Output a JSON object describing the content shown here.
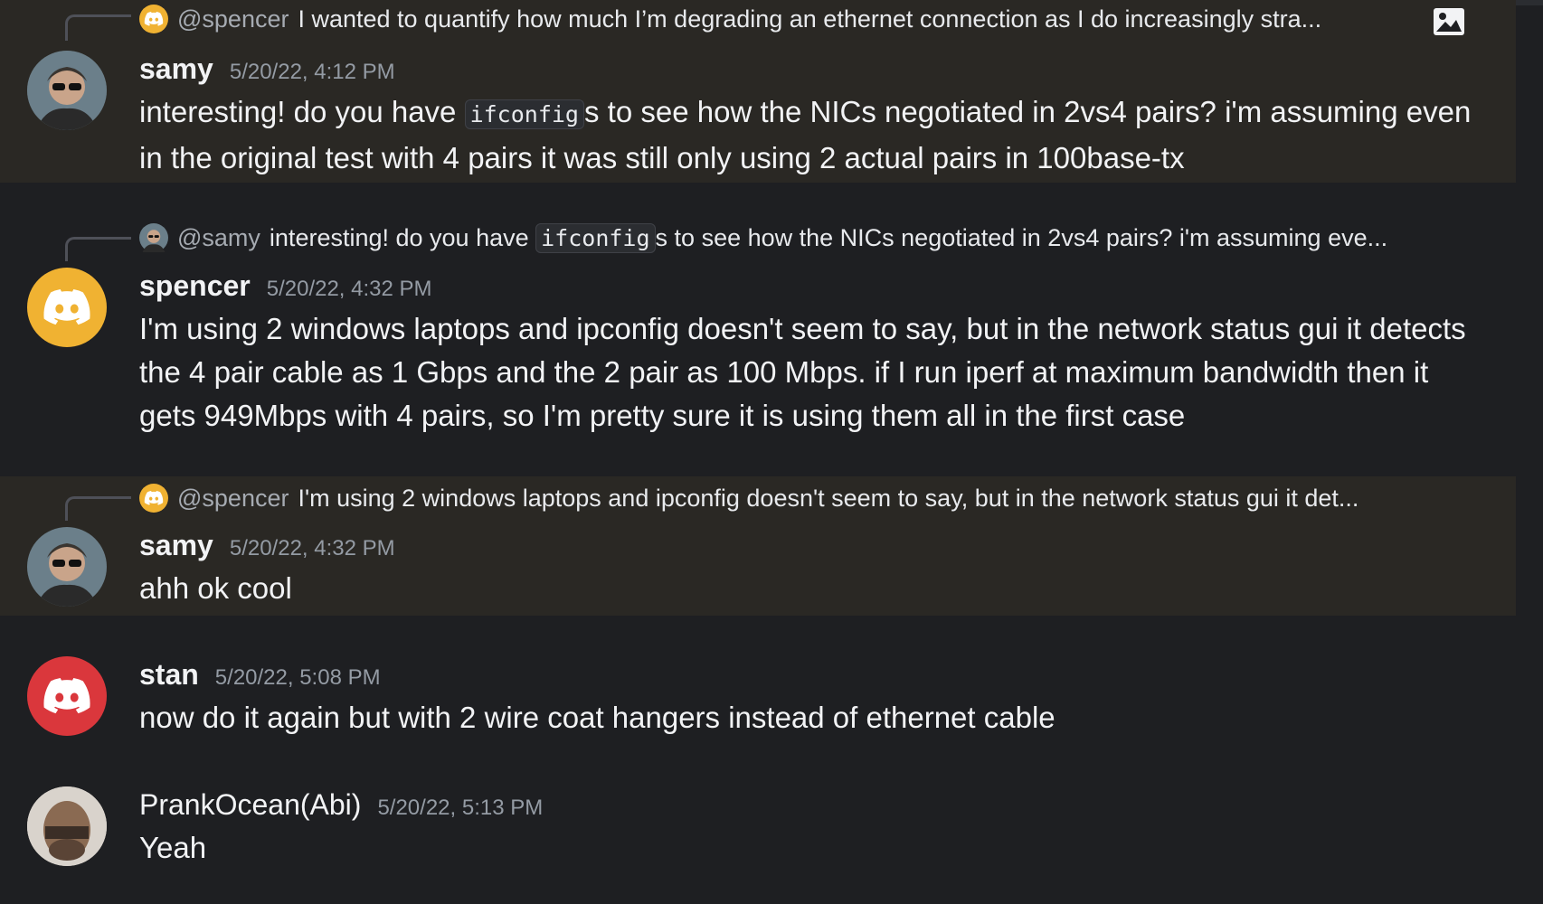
{
  "messages": [
    {
      "username": "samy",
      "timestamp": "5/20/22, 4:12 PM",
      "reply": {
        "user": "@spencer",
        "text": "I wanted to quantify how much I’m degrading an ethernet connection as I do increasingly stra..."
      },
      "body_before": "interesting! do you have ",
      "code": "ifconfig",
      "body_after": "s to see how the NICs negotiated in 2vs4 pairs? i'm assuming even in the original test with 4 pairs it was still only using 2 actual pairs in 100base-tx"
    },
    {
      "username": "spencer",
      "timestamp": "5/20/22, 4:32 PM",
      "reply": {
        "user": "@samy",
        "text_before": "interesting! do you have ",
        "code": "ifconfig",
        "text_after": "s to see how the NICs negotiated in 2vs4 pairs? i'm assuming eve..."
      },
      "body": "I'm using 2 windows laptops and ipconfig doesn't seem to say, but in the network status gui it detects the 4 pair cable as 1 Gbps and the 2 pair as 100 Mbps. if I run iperf at maximum bandwidth then it gets 949Mbps with 4 pairs, so I'm pretty sure it is using them all in the first case"
    },
    {
      "username": "samy",
      "timestamp": "5/20/22, 4:32 PM",
      "reply": {
        "user": "@spencer",
        "text": "I'm using 2 windows laptops and ipconfig doesn't seem to say, but in the network status gui it det..."
      },
      "body": "ahh ok cool"
    },
    {
      "username": "stan",
      "timestamp": "5/20/22, 5:08 PM",
      "body": "now do it again but with 2 wire coat hangers instead of ethernet cable"
    },
    {
      "username": "PrankOcean(Abi)",
      "timestamp": "5/20/22, 5:13 PM",
      "body": "Yeah"
    }
  ],
  "colors": {
    "background": "#1e1f22",
    "highlight": "#2a2824",
    "discord_yellow": "#f0b232",
    "discord_red": "#da373c"
  }
}
